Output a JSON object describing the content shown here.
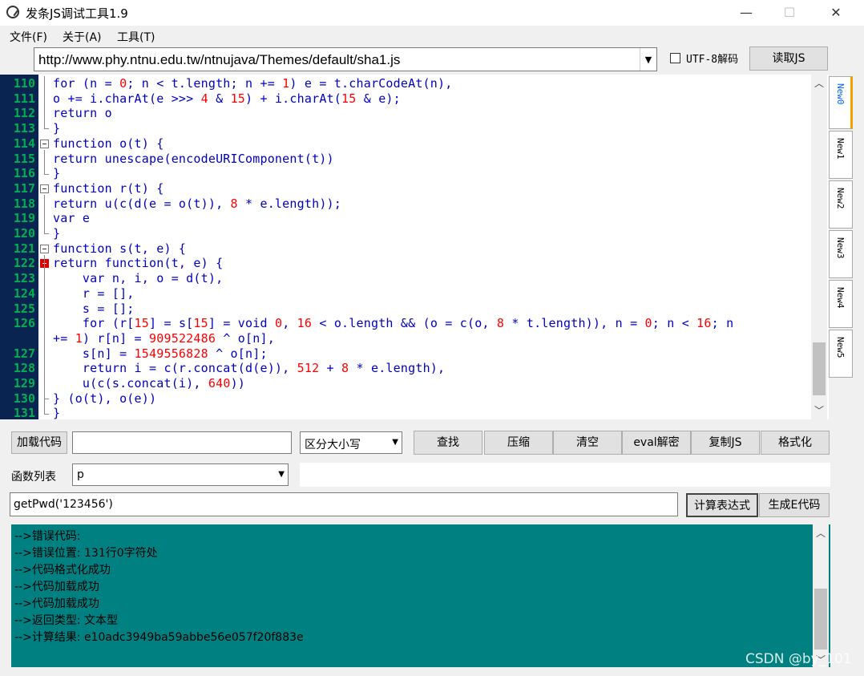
{
  "window": {
    "title": "发条JS调试工具1.9",
    "minimize": "—",
    "maximize": "☐",
    "close": "✕"
  },
  "menu": [
    "文件(F)",
    "关于(A)",
    "工具(T)"
  ],
  "url": {
    "value": "http://www.phy.ntnu.edu.tw/ntnujava/Themes/default/sha1.js",
    "utf8_label": "UTF-8解码",
    "utf8_checked": false,
    "read_button": "读取JS"
  },
  "editor": {
    "lines": [
      {
        "num": "110",
        "html": "for (n = <span class='n'>0</span>; n &lt; t.length; n += <span class='n'>1</span>) e = t.charCodeAt(n),"
      },
      {
        "num": "111",
        "html": "o += i.charAt(e &gt;&gt;&gt; <span class='n'>4</span> &amp; <span class='n'>15</span>) + i.charAt(<span class='n'>15</span> &amp; e);"
      },
      {
        "num": "112",
        "html": "return o"
      },
      {
        "num": "113",
        "html": "}"
      },
      {
        "num": "114",
        "html": "function o(t) {"
      },
      {
        "num": "115",
        "html": "return unescape(encodeURIComponent(t))"
      },
      {
        "num": "116",
        "html": "}"
      },
      {
        "num": "117",
        "html": "function r(t) {"
      },
      {
        "num": "118",
        "html": "return u(c(d(e = o(t)), <span class='n'>8</span> * e.length));"
      },
      {
        "num": "119",
        "html": "var e"
      },
      {
        "num": "120",
        "html": "}"
      },
      {
        "num": "121",
        "html": "function s(t, e) {"
      },
      {
        "num": "122",
        "html": "return function(t, e) {"
      },
      {
        "num": "123",
        "html": "    var n, i, o = d(t),"
      },
      {
        "num": "124",
        "html": "    r = [],"
      },
      {
        "num": "125",
        "html": "    s = [];"
      },
      {
        "num": "126",
        "html": "    for (r[<span class='n'>15</span>] = s[<span class='n'>15</span>] = void <span class='n'>0</span>, <span class='n'>16</span> &lt; o.length &amp;&amp; (o = c(o, <span class='n'>8</span> * t.length)), n = <span class='n'>0</span>; n &lt; <span class='n'>16</span>; n"
      },
      {
        "num": "",
        "html": "+= <span class='n'>1</span>) r[n] = <span class='n'>909522486</span> ^ o[n],"
      },
      {
        "num": "127",
        "html": "    s[n] = <span class='n'>1549556828</span> ^ o[n];"
      },
      {
        "num": "128",
        "html": "    return i = c(r.concat(d(e)), <span class='n'>512</span> + <span class='n'>8</span> * e.length),"
      },
      {
        "num": "129",
        "html": "    u(c(s.concat(i), <span class='n'>640</span>))"
      },
      {
        "num": "130",
        "html": "} (o(t), o(e))"
      },
      {
        "num": "131",
        "html": "}"
      }
    ]
  },
  "tabs": [
    "New0",
    "New1",
    "New2",
    "New3",
    "New4",
    "New5"
  ],
  "toolbar": {
    "load_code": "加载代码",
    "search_value": "",
    "case_option": "区分大小写",
    "find": "查找",
    "compress": "压缩",
    "clear": "清空",
    "eval_decode": "eval解密",
    "copy_js": "复制JS",
    "format": "格式化"
  },
  "functions": {
    "label": "函数列表",
    "selected": "p"
  },
  "expression": {
    "value": "getPwd('123456')",
    "calc_button": "计算表达式",
    "gen_button": "生成E代码"
  },
  "output": [
    "-->错误代码:",
    "-->错误位置: 131行0字符处",
    "-->代码格式化成功",
    "-->代码加载成功",
    "-->代码加载成功",
    "-->返回类型: 文本型",
    "-->计算结果: e10adc3949ba59abbe56e057f20f883e"
  ],
  "watermark": "CSDN @by_101",
  "colors": {
    "gutter": "#0a2452",
    "line_number": "#00b050",
    "code_keyword": "#0000c0",
    "code_number": "#ff0000",
    "output_bg": "#008080"
  }
}
